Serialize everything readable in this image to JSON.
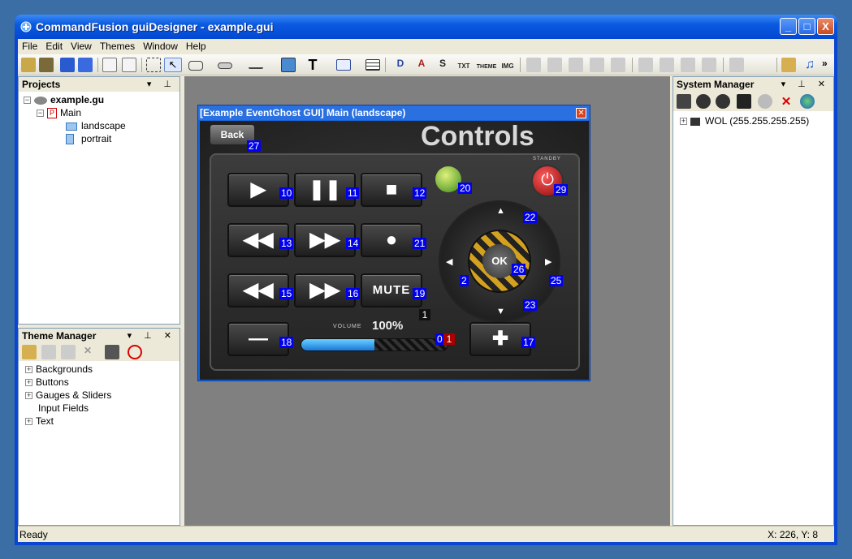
{
  "app": {
    "title": "CommandFusion guiDesigner - example.gui",
    "window_buttons": [
      "_",
      "□",
      "X"
    ]
  },
  "menu": [
    "File",
    "Edit",
    "View",
    "Themes",
    "Window",
    "Help"
  ],
  "toolbar": {
    "icons": [
      "open-theme-icon",
      "open-icon",
      "save-icon",
      "save-all-icon",
      "properties-icon",
      "page-icon",
      "select-region-icon",
      "pointer-icon",
      "button-icon",
      "slider-icon",
      "gauge-icon",
      "image-icon",
      "text-icon",
      "input-icon",
      "list-icon",
      "join-d-icon",
      "join-a-icon",
      "join-s-icon",
      "join-txt-icon",
      "join-theme-icon",
      "join-img-icon",
      "align-left-icon",
      "align-center-icon",
      "align-bottom-icon",
      "align-middle-icon",
      "align-right-icon",
      "size-width-icon",
      "size-height-icon",
      "distribute-v-icon",
      "distribute-h-icon",
      "order-icon",
      "theme-editor-icon",
      "music-icon"
    ],
    "overflow": "»"
  },
  "projects": {
    "title": "Projects",
    "pin": "▾ ⊥",
    "items": [
      "example.gu",
      "Main",
      "landscape",
      "portrait"
    ]
  },
  "theme_manager": {
    "title": "Theme Manager",
    "pin": "▾ ⊥ ✕",
    "items": [
      "Backgrounds",
      "Buttons",
      "Gauges & Sliders",
      "Input Fields",
      "Text"
    ]
  },
  "system_manager": {
    "title": "System Manager",
    "pin": "▾ ⊥ ✕",
    "items": [
      "WOL (255.255.255.255)"
    ]
  },
  "gui_window": {
    "title": "[Example EventGhost GUI] Main (landscape)",
    "close": "✕",
    "heading": "Controls",
    "back_label": "Back",
    "standby_label": "STANDBY",
    "volume_label": "VOLUME",
    "volume_value": "100%",
    "volume_fraction": 0.5,
    "ok_label": "OK",
    "mute_label": "MUTE",
    "buttons": {
      "play": "▶",
      "pause": "❚❚",
      "stop": "■",
      "rewind": "◀◀",
      "forward": "▶▶",
      "record": "●",
      "prev": "◀◀",
      "next": "▶▶",
      "minus": "—",
      "plus": "✚"
    },
    "tags": {
      "back": "27",
      "windows": "20",
      "power": "29",
      "play": "10",
      "pause": "11",
      "stop": "12",
      "rewind": "13",
      "forward": "14",
      "record": "21",
      "prev": "15",
      "next": "16",
      "mute": "19",
      "minus": "18",
      "plus": "17",
      "dpad_top": "22",
      "dpad_center": "26",
      "dpad_right": "25",
      "dpad_bottom": "23",
      "dpad_left": "2",
      "vol_one": "1",
      "vol_zero": "0",
      "vol_red": "1"
    }
  },
  "status": {
    "left": "Ready",
    "right": "X: 226, Y: 8"
  }
}
